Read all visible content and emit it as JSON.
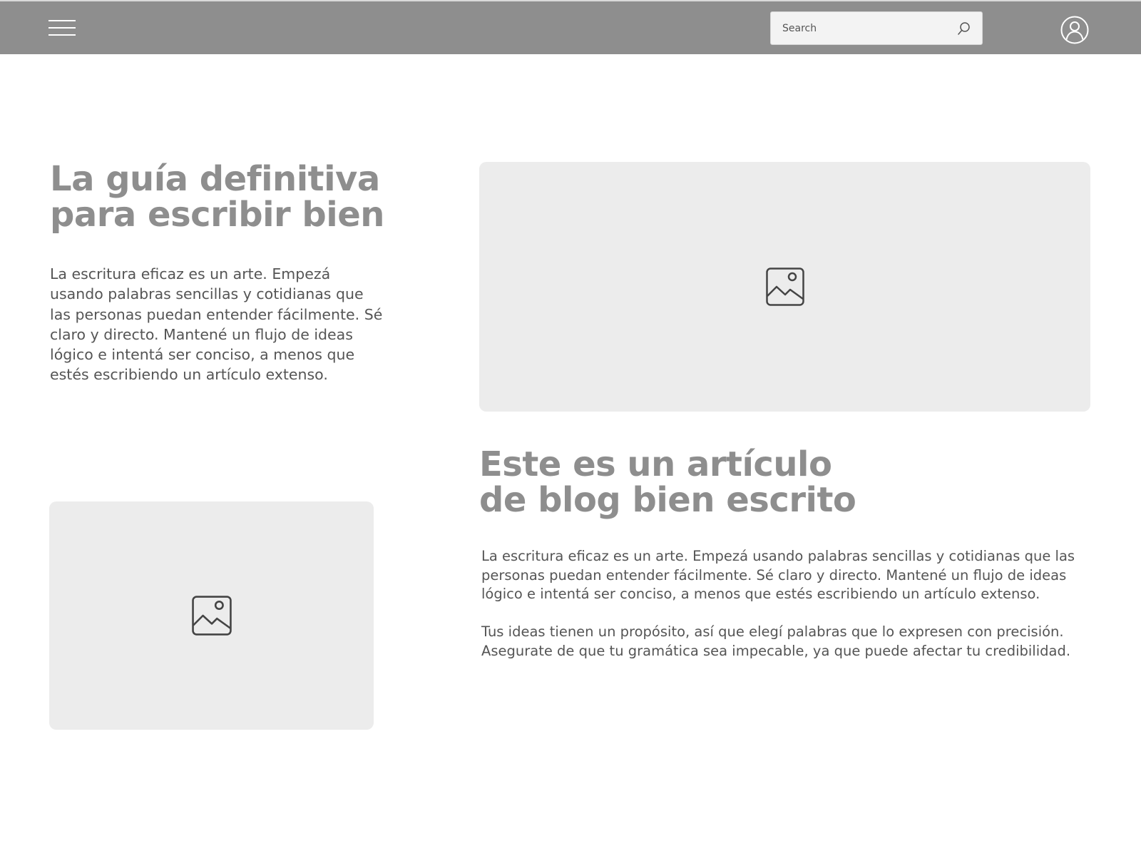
{
  "header": {
    "search_placeholder": "Search",
    "menu_icon": "hamburger-menu-icon",
    "search_icon": "search-icon",
    "profile_icon": "user-avatar-icon"
  },
  "section_1": {
    "title_line_1": "La guía definitiva",
    "title_line_2": "para escribir bien",
    "paragraph": "La escritura eficaz es un arte. Empezá usando palabras sencillas y cotidianas que las personas puedan entender fácilmente. Sé claro y directo. Mantené un flujo de ideas lógico e intentá ser conciso, a menos que estés escribiendo un artículo extenso.",
    "image_icon": "image-placeholder-icon"
  },
  "section_2": {
    "title_line_1": "Este es un artículo",
    "title_line_2": "de blog bien escrito",
    "paragraph_1": "La escritura eficaz es un arte. Empezá usando palabras sencillas y cotidianas que las personas puedan entender fácilmente. Sé claro y directo. Mantené un flujo de ideas lógico e intentá ser conciso, a menos que estés escribiendo un artículo extenso.",
    "paragraph_2": "Tus ideas tienen un propósito, así que elegí palabras que lo expresen con precisión. Asegurate de que tu gramática sea impecable, ya que puede afectar tu credibilidad.",
    "image_icon": "image-placeholder-icon"
  },
  "colors": {
    "header_bg": "#8e8e8e",
    "title": "#8e8e8e",
    "body_text": "#555555",
    "placeholder_bg": "#ececec",
    "icon_stroke": "#444444"
  }
}
